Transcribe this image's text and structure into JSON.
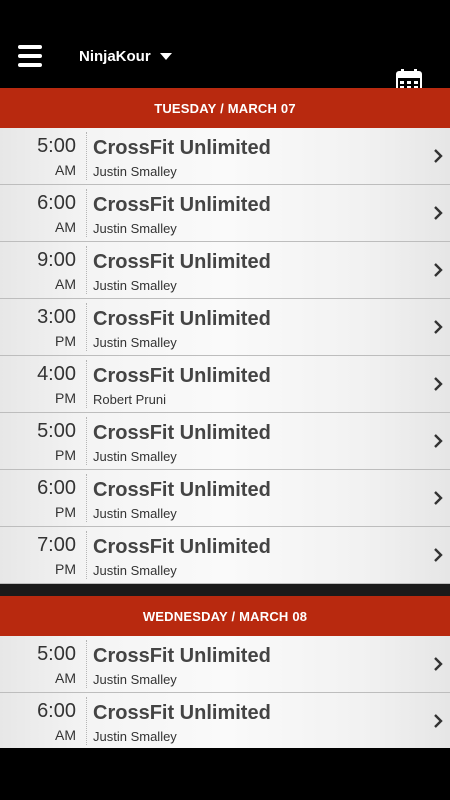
{
  "header": {
    "gym_name": "NinjaKour",
    "menu_icon": "hamburger-menu-icon",
    "calendar_icon": "calendar-icon"
  },
  "colors": {
    "day_header": "#b8290f",
    "background": "#000000"
  },
  "days": [
    {
      "label": "TUESDAY / MARCH 07",
      "classes": [
        {
          "time": "5:00",
          "period": "AM",
          "title": "CrossFit Unlimited",
          "coach": "Justin Smalley"
        },
        {
          "time": "6:00",
          "period": "AM",
          "title": "CrossFit Unlimited",
          "coach": "Justin Smalley"
        },
        {
          "time": "9:00",
          "period": "AM",
          "title": "CrossFit Unlimited",
          "coach": "Justin Smalley"
        },
        {
          "time": "3:00",
          "period": "PM",
          "title": "CrossFit Unlimited",
          "coach": "Justin Smalley"
        },
        {
          "time": "4:00",
          "period": "PM",
          "title": "CrossFit Unlimited",
          "coach": "Robert Pruni"
        },
        {
          "time": "5:00",
          "period": "PM",
          "title": "CrossFit Unlimited",
          "coach": "Justin Smalley"
        },
        {
          "time": "6:00",
          "period": "PM",
          "title": "CrossFit Unlimited",
          "coach": "Justin Smalley"
        },
        {
          "time": "7:00",
          "period": "PM",
          "title": "CrossFit Unlimited",
          "coach": "Justin Smalley"
        }
      ]
    },
    {
      "label": "WEDNESDAY / MARCH 08",
      "classes": [
        {
          "time": "5:00",
          "period": "AM",
          "title": "CrossFit Unlimited",
          "coach": "Justin Smalley"
        },
        {
          "time": "6:00",
          "period": "AM",
          "title": "CrossFit Unlimited",
          "coach": "Justin Smalley"
        }
      ]
    }
  ]
}
